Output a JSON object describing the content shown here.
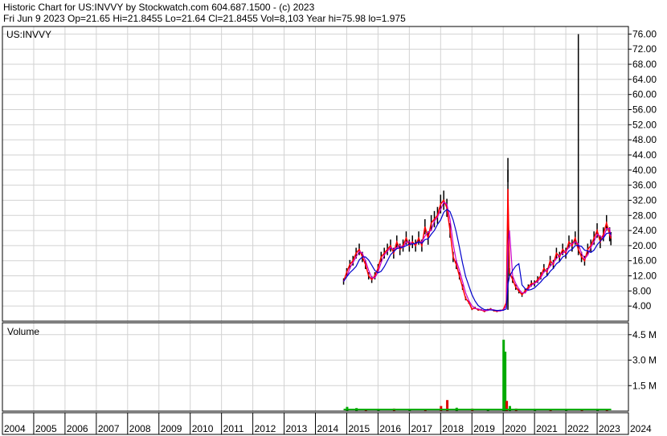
{
  "header": {
    "line1": "Historic Chart for US:INVVY by Stockwatch.com 604.687.1500 - (c) 2023",
    "line2": "Fri Jun  9 2023  Op=21.65  Hi=21.8455  Lo=21.64  Cl=21.8455  Vol=8,103  Year hi=75.98  lo=1.975"
  },
  "colors": {
    "price_ohlc": "#000000",
    "price_close_line": "#ff0000",
    "ma_short": "#cc00cc",
    "ma_long": "#0000cc",
    "volume_up": "#00aa00",
    "volume_down": "#dd0000",
    "grid": "#d2d2d2"
  },
  "chart_data": [
    {
      "type": "line",
      "title": "US:INVVY",
      "x_unit": "year",
      "xlim": [
        2004,
        2024
      ],
      "ylim": [
        0,
        78
      ],
      "y_ticks": [
        4,
        8,
        12,
        16,
        20,
        24,
        28,
        32,
        36,
        40,
        44,
        48,
        52,
        56,
        60,
        64,
        68,
        72,
        76
      ],
      "y_tick_labels": [
        "4.00",
        "8.00",
        "12.00",
        "16.00",
        "20.00",
        "24.00",
        "28.00",
        "32.00",
        "36.00",
        "40.00",
        "44.00",
        "48.00",
        "52.00",
        "56.00",
        "60.00",
        "64.00",
        "68.00",
        "72.00",
        "76.00"
      ],
      "grid": true,
      "series": [
        {
          "role": "close",
          "x": [
            2014.9,
            2015.0,
            2015.1,
            2015.2,
            2015.3,
            2015.4,
            2015.5,
            2015.6,
            2015.7,
            2015.8,
            2015.9,
            2016.0,
            2016.1,
            2016.2,
            2016.3,
            2016.4,
            2016.5,
            2016.6,
            2016.7,
            2016.8,
            2016.9,
            2017.0,
            2017.1,
            2017.2,
            2017.3,
            2017.4,
            2017.5,
            2017.6,
            2017.7,
            2017.8,
            2017.9,
            2018.0,
            2018.1,
            2018.2,
            2018.3,
            2018.4,
            2018.5,
            2018.6,
            2018.7,
            2018.8,
            2018.9,
            2019.0,
            2019.1,
            2019.2,
            2019.3,
            2019.4,
            2019.5,
            2019.6,
            2019.7,
            2019.8,
            2019.9,
            2020.0,
            2020.1,
            2020.15,
            2020.2,
            2020.3,
            2020.4,
            2020.5,
            2020.6,
            2020.7,
            2020.8,
            2020.9,
            2021.0,
            2021.1,
            2021.2,
            2021.3,
            2021.4,
            2021.5,
            2021.6,
            2021.7,
            2021.8,
            2021.9,
            2022.0,
            2022.1,
            2022.2,
            2022.3,
            2022.4,
            2022.5,
            2022.6,
            2022.7,
            2022.8,
            2022.9,
            2023.0,
            2023.1,
            2023.2,
            2023.3,
            2023.4,
            2023.44
          ],
          "values": [
            10.5,
            13,
            15,
            16,
            18,
            19,
            17,
            15,
            12,
            11,
            12,
            14,
            17,
            18,
            19,
            20,
            18,
            21,
            19,
            20,
            22,
            20,
            21,
            20,
            22,
            20,
            25,
            22,
            26,
            27,
            28,
            31,
            32,
            30,
            24,
            17,
            15,
            12,
            9,
            6,
            5,
            3.2,
            3.5,
            3,
            3,
            2.6,
            3,
            3.2,
            2.8,
            2.6,
            2.8,
            3,
            5,
            40,
            13,
            11,
            9,
            8,
            7,
            8,
            9,
            10,
            10,
            11,
            12,
            14,
            13,
            16,
            15,
            18,
            17,
            19,
            18,
            21,
            20,
            22,
            19,
            17,
            16,
            19,
            20,
            22,
            24,
            21,
            23,
            26,
            23,
            21.85
          ]
        },
        {
          "role": "short_ma",
          "values": []
        },
        {
          "role": "long_ma",
          "values": []
        }
      ],
      "annotations": [
        "spike 2020 to about 40",
        "spike 2022.4 to 75.98"
      ]
    },
    {
      "type": "bar",
      "title": "Volume",
      "ylim": [
        0,
        5200000
      ],
      "y_ticks": [
        1500000,
        3000000,
        4500000
      ],
      "y_tick_labels": [
        "1.5 M",
        "3.0 M",
        "4.5 M"
      ],
      "x": [
        2015.0,
        2015.3,
        2015.6,
        2016.0,
        2016.5,
        2017.0,
        2017.5,
        2018.0,
        2018.2,
        2018.5,
        2019.0,
        2019.5,
        2020.0,
        2020.05,
        2020.1,
        2020.2,
        2020.4,
        2021.0,
        2021.5,
        2022.0,
        2022.5,
        2023.0,
        2023.3
      ],
      "values": [
        250000,
        180000,
        120000,
        90000,
        150000,
        100000,
        120000,
        300000,
        650000,
        200000,
        150000,
        120000,
        4200000,
        3500000,
        600000,
        300000,
        150000,
        90000,
        80000,
        100000,
        120000,
        90000,
        80000
      ],
      "colors": [
        "up",
        "up",
        "down",
        "up",
        "down",
        "up",
        "down",
        "down",
        "down",
        "up",
        "down",
        "up",
        "up",
        "up",
        "down",
        "up",
        "down",
        "up",
        "down",
        "up",
        "down",
        "up",
        "down"
      ]
    }
  ],
  "x_axis": {
    "ticks": [
      "2004",
      "2005",
      "2006",
      "2007",
      "2008",
      "2009",
      "2010",
      "2011",
      "2012",
      "2013",
      "2014",
      "2015",
      "2016",
      "2017",
      "2018",
      "2019",
      "2020",
      "2021",
      "2022",
      "2023",
      "2024"
    ]
  }
}
